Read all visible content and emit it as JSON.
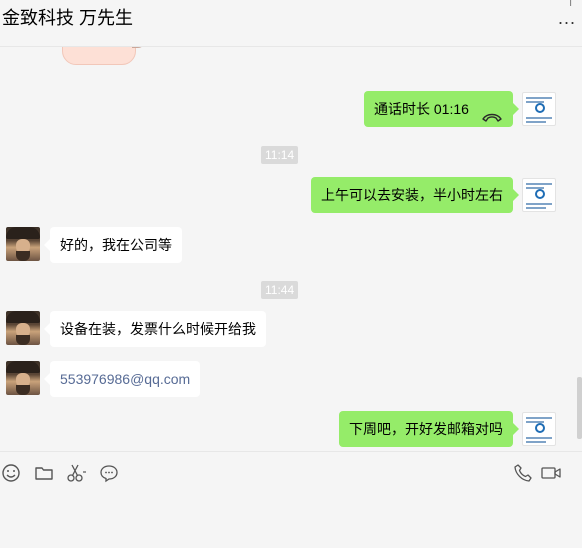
{
  "header": {
    "title": "金致科技 万先生",
    "more": "...",
    "topbits": "|"
  },
  "messages": [
    {
      "type": "call",
      "side": "right",
      "text": "通话时长 01:16"
    },
    {
      "type": "time",
      "text": "11:14"
    },
    {
      "type": "text",
      "side": "right",
      "text": "上午可以去安装，半小时左右"
    },
    {
      "type": "text",
      "side": "left",
      "text": "好的，我在公司等"
    },
    {
      "type": "time",
      "text": "11:44"
    },
    {
      "type": "text",
      "side": "left",
      "text": "设备在装，发票什么时候开给我"
    },
    {
      "type": "link",
      "side": "left",
      "text": "553976986@qq.com"
    },
    {
      "type": "text",
      "side": "right",
      "text": "下周吧，开好发邮箱对吗"
    }
  ],
  "toolbar": {
    "left_icons": [
      "emoji-icon",
      "folder-icon",
      "scissors-icon",
      "chat-bubble-icon"
    ],
    "right_icons": [
      "phone-icon",
      "video-camera-icon"
    ]
  },
  "colors": {
    "bubble_right": "#95ec69",
    "bubble_left": "#ffffff",
    "background": "#f5f5f5",
    "timestamp_bg": "#dadada",
    "link": "#576b95"
  }
}
